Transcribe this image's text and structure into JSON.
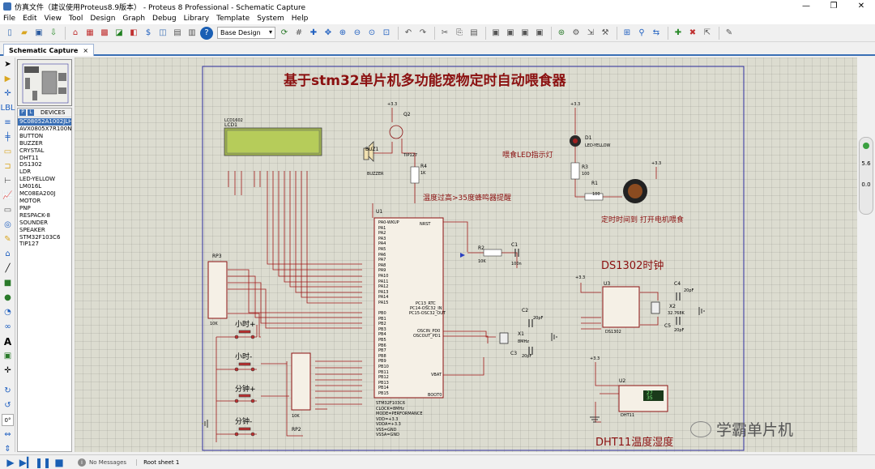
{
  "window": {
    "title": "仿真文件（建议使用Proteus8.9版本） - Proteus 8 Professional - Schematic Capture",
    "min": "—",
    "max": "❐",
    "close": "✕"
  },
  "menu": [
    "File",
    "Edit",
    "View",
    "Tool",
    "Design",
    "Graph",
    "Debug",
    "Library",
    "Template",
    "System",
    "Help"
  ],
  "toolbar": {
    "design_select": "Base Design"
  },
  "tab": {
    "label": "Schematic Capture",
    "close": "×"
  },
  "devices": {
    "header": "DEVICES",
    "p_btn": "P",
    "l_btn": "L",
    "items": [
      "9C08052A1002JLH",
      "AVX0805X7R100N",
      "BUTTON",
      "BUZZER",
      "CRYSTAL",
      "DHT11",
      "DS1302",
      "LDR",
      "LED-YELLOW",
      "LM016L",
      "MC08EA200J",
      "MOTOR",
      "PNP",
      "RESPACK-8",
      "SOUNDER",
      "SPEAKER",
      "STM32F103C6",
      "TIP127"
    ],
    "selected": 0
  },
  "schematic": {
    "title": "基于stm32单片机多功能宠物定时自动喂食器",
    "sections": {
      "ds1302": "DS1302时钟",
      "dht11": "DHT11温度湿度"
    },
    "notes": {
      "led": "喂食LED指示灯",
      "buzzer": "温度过高>35度蜂鸣器提醒",
      "motor": "定时时间到 打开电机喂食"
    },
    "lcd": {
      "ref": "LCD1",
      "part": "LCD1602"
    },
    "mcu": {
      "ref": "U1",
      "part": "STM32F103C6",
      "left_pins": [
        "PA0-WKUP",
        "PA1",
        "PA2",
        "PA3",
        "PA4",
        "PA5",
        "PA6",
        "PA7",
        "PA8",
        "PA9",
        "PA10",
        "PA11",
        "PA12",
        "PA13",
        "PA14",
        "PA15",
        "",
        "PB0",
        "PB1",
        "PB2",
        "PB3",
        "PB4",
        "PB5",
        "PB6",
        "PB7",
        "PB8",
        "PB9",
        "PB10",
        "PB11",
        "PB12",
        "PB13",
        "PB14",
        "PB15"
      ],
      "right_pins": [
        "NRST",
        "PC13_RTC",
        "PC14-OSC32_IN",
        "PC15-OSC32_OUT",
        "OSCIN_PD0",
        "OSCOUT_PD1",
        "VBAT",
        "BOOT0"
      ],
      "info": [
        "STM32F103C6",
        "CLOCK=8MHz",
        "MODE=PERFORMANCE",
        "VDD=+3.3",
        "VDDA=+3.3",
        "VSS=GND",
        "VSSA=GND"
      ]
    },
    "parts": {
      "q2": "Q2",
      "tip127": "TIP127",
      "buz1": "BUZ1",
      "buzzer": "BUZZER",
      "r4": "R4",
      "r4v": "1K",
      "d1": "D1",
      "ledy": "LED-YELLOW",
      "r3": "R3",
      "r3v": "100",
      "r1": "R1",
      "r1v": "100",
      "r2": "R2",
      "r2v": "10K",
      "c1": "C1",
      "c1v": "100n",
      "c2": "C2",
      "c2v": "20pF",
      "c3": "C3",
      "c3v": "20pF",
      "x1": "X1",
      "x1v": "8MHz",
      "u3": "U3",
      "ds1302": "DS1302",
      "c4": "C4",
      "c4v": "20pF",
      "c5": "C5",
      "c5v": "20pF",
      "x2": "X2",
      "x2v": "32.768K",
      "u2": "U2",
      "dht11": "DHT11",
      "rp3": "RP3",
      "rp3v": "10K",
      "rp2": "RP2",
      "rp2v": "10K",
      "v33": "+3.3"
    },
    "buttons": [
      "小时+",
      "小时-",
      "分钟+",
      "分钟-"
    ],
    "dht_display": [
      "27",
      "35"
    ],
    "watermark": "学霸单片机"
  },
  "zoom": {
    "top": "5.6",
    "bottom": "0.0"
  },
  "status": {
    "messages": "No Messages",
    "sheet": "Root sheet 1"
  }
}
